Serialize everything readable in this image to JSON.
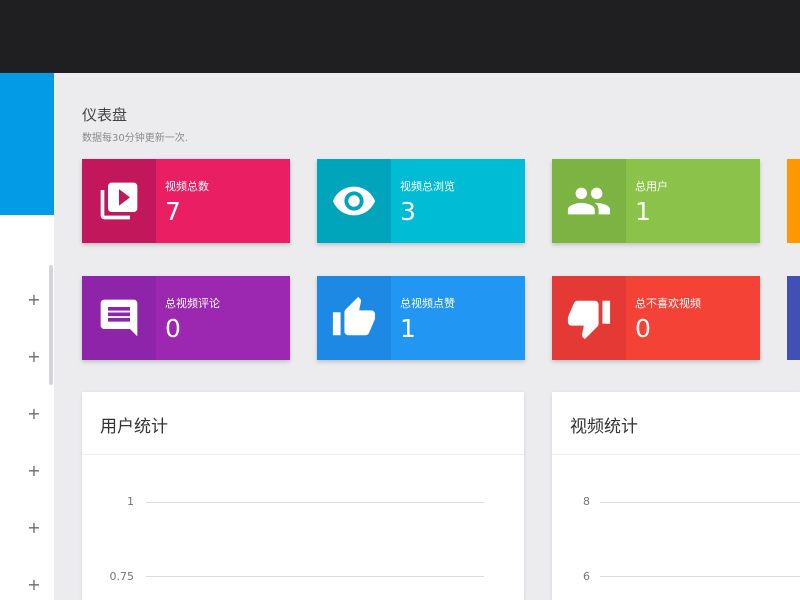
{
  "header": {
    "title": "仪表盘",
    "subtitle": "数据每30分钟更新一次."
  },
  "sidebar": {
    "expand_symbol": "+"
  },
  "stats": [
    {
      "label": "视频总数",
      "value": "7",
      "icon": "video-library-icon",
      "color": "#e91e63",
      "icon_color": "#c2185b"
    },
    {
      "label": "视频总浏览",
      "value": "3",
      "icon": "eye-icon",
      "color": "#00bcd4",
      "icon_color": "#00a5bb"
    },
    {
      "label": "总用户",
      "value": "1",
      "icon": "users-icon",
      "color": "#8bc34a",
      "icon_color": "#7cb342"
    },
    {
      "label": "总视频评论",
      "value": "0",
      "icon": "comment-icon",
      "color": "#9c27b0",
      "icon_color": "#8e24aa"
    },
    {
      "label": "总视频点赞",
      "value": "1",
      "icon": "thumbs-up-icon",
      "color": "#2196f3",
      "icon_color": "#1e88e5"
    },
    {
      "label": "总不喜欢视频",
      "value": "0",
      "icon": "thumbs-down-icon",
      "color": "#f44336",
      "icon_color": "#e53935"
    }
  ],
  "user_chart": {
    "title": "用户统计",
    "y_ticks": [
      "1",
      "0.75"
    ]
  },
  "video_chart": {
    "title": "视频统计",
    "y_ticks": [
      "8",
      "6"
    ]
  }
}
